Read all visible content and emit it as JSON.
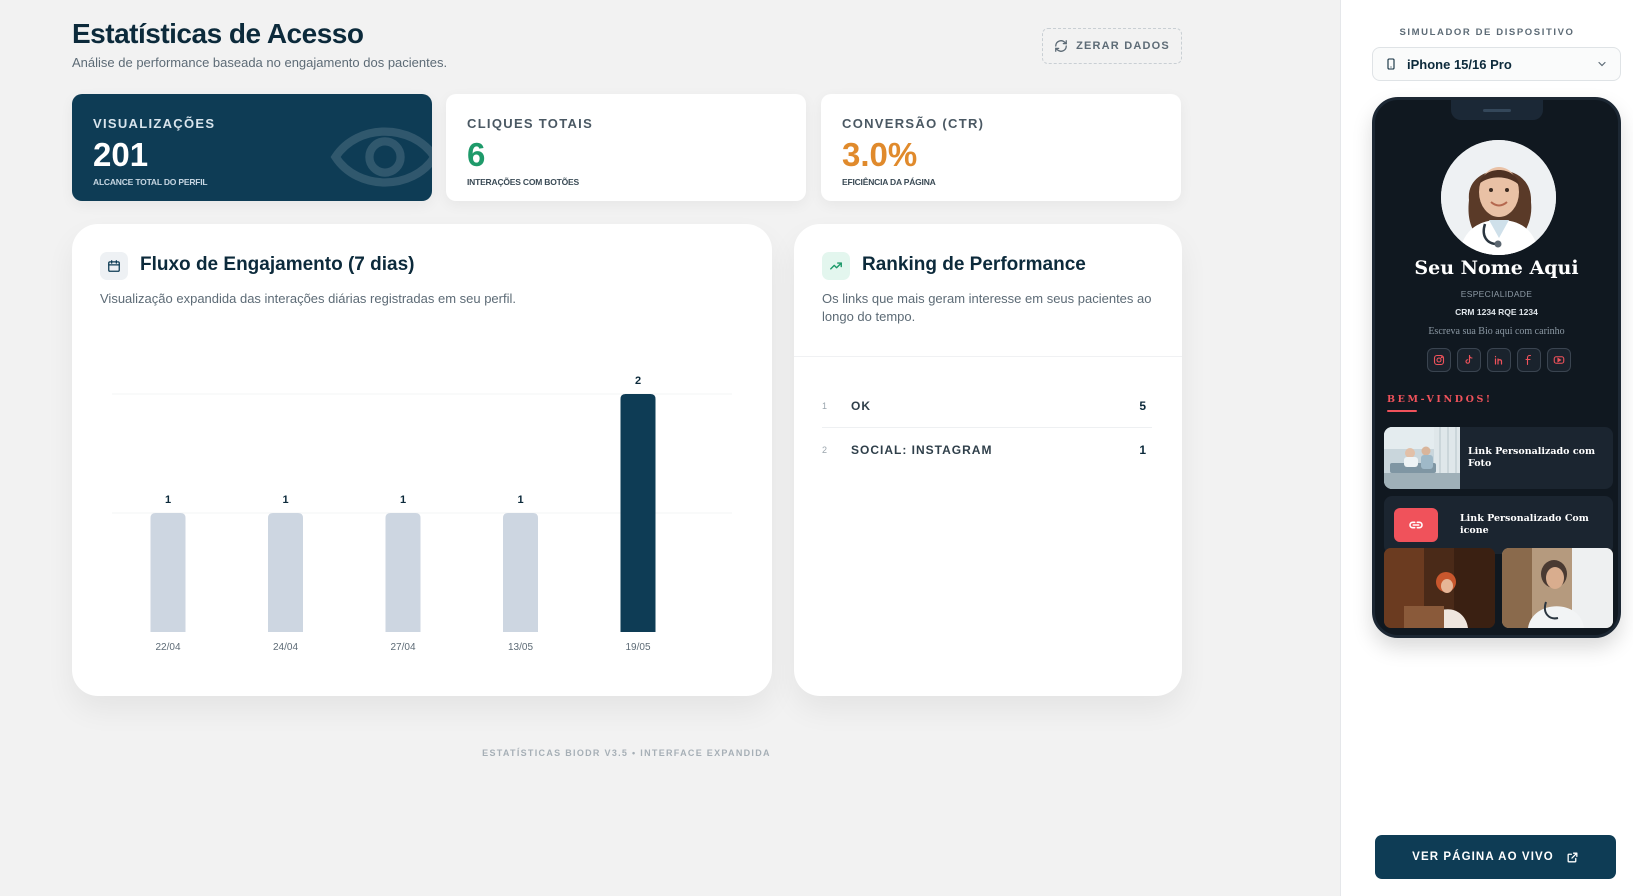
{
  "header": {
    "title": "Estatísticas de Acesso",
    "subtitle": "Análise de performance baseada no engajamento dos pacientes.",
    "reset_label": "ZERAR DADOS"
  },
  "stats": [
    {
      "label": "VISUALIZAÇÕES",
      "value": "201",
      "caption": "ALCANCE TOTAL DO PERFIL",
      "color": "#ffffff"
    },
    {
      "label": "CLIQUES TOTAIS",
      "value": "6",
      "caption": "INTERAÇÕES COM BOTÕES",
      "color": "#1e9a6a"
    },
    {
      "label": "CONVERSÃO (CTR)",
      "value": "3.0%",
      "caption": "EFICIÊNCIA DA PÁGINA",
      "color": "#e08a2c"
    }
  ],
  "engagement": {
    "title": "Fluxo de Engajamento (7 dias)",
    "description": "Visualização expandida das interações diárias registradas em seu perfil."
  },
  "chart_data": {
    "type": "bar",
    "categories": [
      "22/04",
      "24/04",
      "27/04",
      "13/05",
      "19/05"
    ],
    "values": [
      1,
      1,
      1,
      1,
      2
    ],
    "ylim": [
      0,
      2
    ],
    "colors": {
      "default": "#cdd6e1",
      "highlight": "#0e3c55"
    },
    "grid": true,
    "data_labels": true
  },
  "ranking": {
    "title": "Ranking de Performance",
    "description": "Os links que mais geram interesse em seus pacientes ao longo do tempo.",
    "items": [
      {
        "rank": "1",
        "label": "OK",
        "count": "5"
      },
      {
        "rank": "2",
        "label": "SOCIAL: INSTAGRAM",
        "count": "1"
      }
    ]
  },
  "footer": "ESTATÍSTICAS BIODR V3.5 • INTERFACE EXPANDIDA",
  "simulator": {
    "title": "SIMULADOR DE DISPOSITIVO",
    "device": "iPhone 15/16 Pro",
    "profile": {
      "name": "Seu Nome Aqui",
      "specialty": "ESPECIALIDADE",
      "crm": "CRM 1234  RQE 1234",
      "bio": "Escreva sua Bio aqui com carinho",
      "socials": [
        "instagram-icon",
        "tiktok-icon",
        "linkedin-icon",
        "facebook-icon",
        "youtube-icon"
      ],
      "welcome": "BEM-VINDOS!",
      "link_photo": "Link Personalizado com Foto",
      "link_icon": "Link Personalizado Com icone"
    },
    "live_label": "VER PÁGINA AO VIVO",
    "accent": "#f0525b"
  }
}
